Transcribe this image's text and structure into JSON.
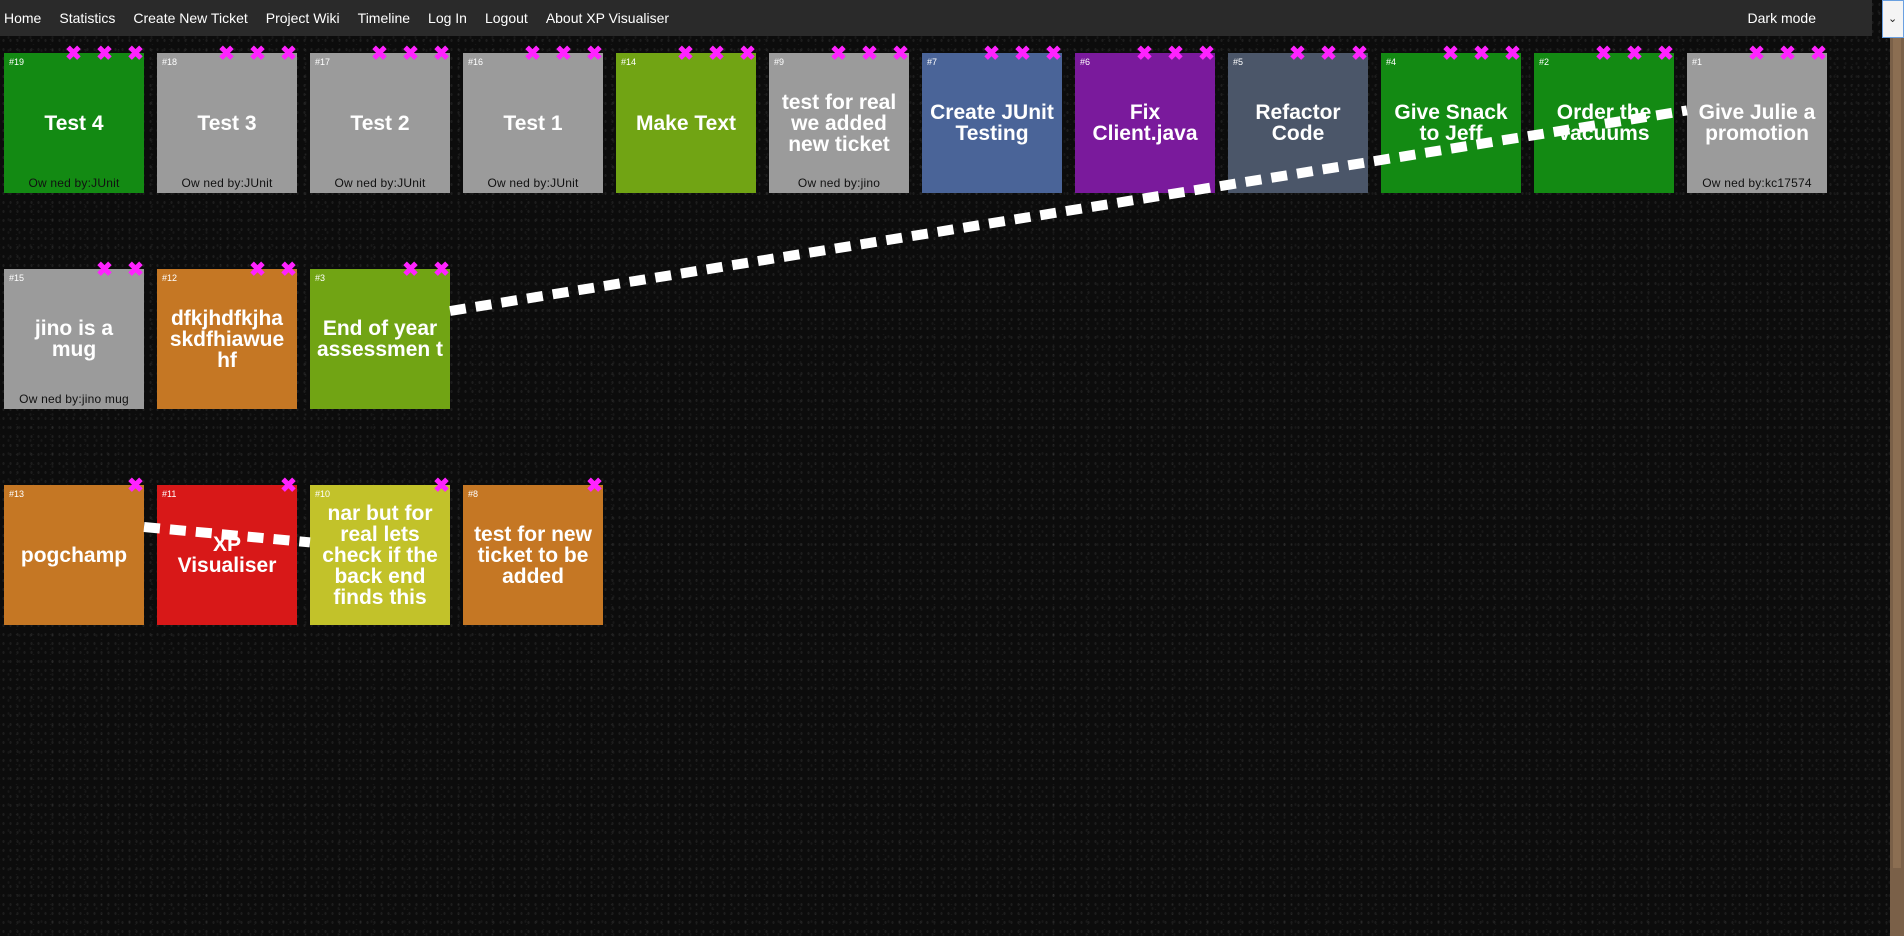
{
  "nav": {
    "links": [
      "Home",
      "Statistics",
      "Create New Ticket",
      "Project Wiki",
      "Timeline",
      "Log In",
      "Logout",
      "About XP Visualiser"
    ],
    "dark_mode_label": "Dark mode"
  },
  "colors": {
    "green": "#138a13",
    "gray": "#9b9b9b",
    "olive": "#71a414",
    "slate_blue": "#4a6498",
    "purple": "#7a1a9c",
    "steel": "#4b5669",
    "orange": "#c57724",
    "red": "#d81818",
    "yellow": "#c2c22a",
    "delete_x": "#ff22ff"
  },
  "tickets": [
    {
      "id": "#19",
      "title": "Test 4",
      "owner": "Ow ned by:JUnit",
      "color": "#138a13",
      "xcount": 3
    },
    {
      "id": "#18",
      "title": "Test 3",
      "owner": "Ow ned by:JUnit",
      "color": "#9b9b9b",
      "xcount": 3
    },
    {
      "id": "#17",
      "title": "Test 2",
      "owner": "Ow ned by:JUnit",
      "color": "#9b9b9b",
      "xcount": 3
    },
    {
      "id": "#16",
      "title": "Test 1",
      "owner": "Ow ned by:JUnit",
      "color": "#9b9b9b",
      "xcount": 3
    },
    {
      "id": "#14",
      "title": "Make Text",
      "owner": "",
      "color": "#71a414",
      "xcount": 3
    },
    {
      "id": "#9",
      "title": "test for real we added new ticket",
      "owner": "Ow ned by:jino",
      "color": "#9b9b9b",
      "xcount": 3
    },
    {
      "id": "#7",
      "title": "Create JUnit Testing",
      "owner": "",
      "color": "#4a6498",
      "xcount": 3
    },
    {
      "id": "#6",
      "title": "Fix Client.java",
      "owner": "",
      "color": "#7a1a9c",
      "xcount": 3
    },
    {
      "id": "#5",
      "title": "Refactor Code",
      "owner": "",
      "color": "#4b5669",
      "xcount": 3
    },
    {
      "id": "#4",
      "title": "Give Snack to Jeff",
      "owner": "",
      "color": "#138a13",
      "xcount": 3
    },
    {
      "id": "#2",
      "title": "Order the vacuums",
      "owner": "",
      "color": "#138a13",
      "xcount": 3
    },
    {
      "id": "#1",
      "title": "Give Julie a promotion",
      "owner": "Ow ned by:kc17574",
      "color": "#9b9b9b",
      "xcount": 3
    },
    {
      "id": "#15",
      "title": "jino is a mug",
      "owner": "Ow ned by:jino mug",
      "color": "#9b9b9b",
      "xcount": 2
    },
    {
      "id": "#12",
      "title": "dfkjhdfkjha skdfhiawue hf",
      "owner": "",
      "color": "#c57724",
      "xcount": 2
    },
    {
      "id": "#3",
      "title": "End of year assessmen t",
      "owner": "",
      "color": "#71a414",
      "xcount": 2
    },
    {
      "id": "#13",
      "title": "pogchamp",
      "owner": "",
      "color": "#c57724",
      "xcount": 1
    },
    {
      "id": "#11",
      "title": "XP Visualiser",
      "owner": "",
      "color": "#d81818",
      "xcount": 1
    },
    {
      "id": "#10",
      "title": "nar but for real lets check if the back end finds this",
      "owner": "",
      "color": "#c2c22a",
      "xcount": 1
    },
    {
      "id": "#8",
      "title": "test for new ticket to be added",
      "owner": "",
      "color": "#c57724",
      "xcount": 1
    }
  ],
  "dependency_links": [
    {
      "from": "#3",
      "to": "#1"
    },
    {
      "from": "#13",
      "to": "#10"
    }
  ]
}
